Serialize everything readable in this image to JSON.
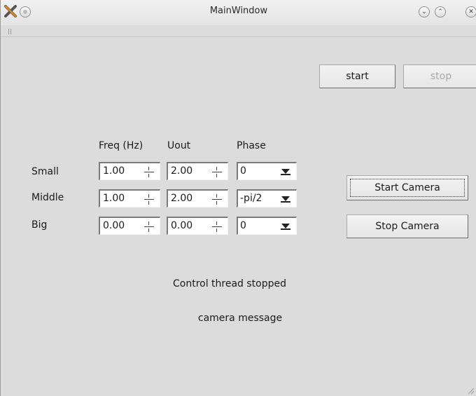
{
  "window": {
    "title": "MainWindow"
  },
  "titlebar": {
    "app_icon": "x-app-icon",
    "menu_icon": "circle-menu-icon",
    "controls": [
      "minimize-icon",
      "maximize-icon",
      "close-icon"
    ]
  },
  "top_buttons": {
    "start_label": "start",
    "stop_label": "stop"
  },
  "grid": {
    "headers": {
      "freq": "Freq (Hz)",
      "uout": "Uout",
      "phase": "Phase"
    },
    "rows": [
      {
        "label": "Small",
        "freq": "1.00",
        "uout": "2.00",
        "phase": "0"
      },
      {
        "label": "Middle",
        "freq": "1.00",
        "uout": "2.00",
        "phase": "-pi/2"
      },
      {
        "label": "Big",
        "freq": "0.00",
        "uout": "0.00",
        "phase": "0"
      }
    ]
  },
  "camera_buttons": {
    "start_label": "Start Camera",
    "stop_label": "Stop Camera"
  },
  "status": {
    "control_thread": "Control thread stopped",
    "camera": "camera message"
  },
  "colors": {
    "window_bg": "#dcdcdc",
    "disabled_text": "#a8a8a8"
  }
}
